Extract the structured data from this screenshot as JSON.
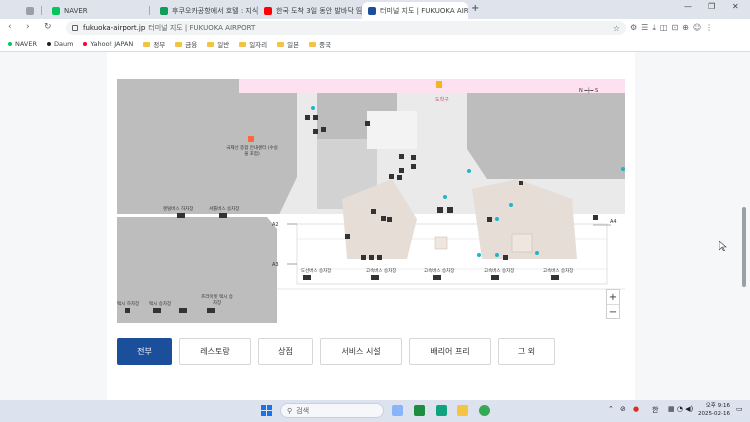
{
  "browser": {
    "tabs": [
      {
        "label": "NAVER",
        "color": "#03c75a",
        "active": false
      },
      {
        "label": "후쿠오카공항에서 호텔 : 지식",
        "color": "#0f9d58",
        "active": false
      },
      {
        "label": "한국 도착 3일 동안 발바닥 땀",
        "color": "#ff0000",
        "active": false
      },
      {
        "label": "터미널 지도 | FUKUOKA AIRP",
        "color": "#1b4f9c",
        "active": true
      }
    ],
    "new_tab": "+",
    "window_controls": {
      "minimize": "—",
      "maximize": "❐",
      "close": "✕"
    },
    "nav": {
      "back": "‹",
      "forward": "›",
      "reload": "↻"
    },
    "url_host": "fukuoka-airport.jp",
    "url_title": "터미널 지도 | FUKUOKA AIRPORT",
    "bookmarks": [
      {
        "label": "NAVER",
        "type": "dot",
        "color": "#03c75a"
      },
      {
        "label": "Daum",
        "type": "dot",
        "color": "#222222"
      },
      {
        "label": "Yahoo! JAPAN",
        "type": "dot",
        "color": "#ff0033"
      },
      {
        "label": "정부",
        "type": "folder"
      },
      {
        "label": "금융",
        "type": "folder"
      },
      {
        "label": "일반",
        "type": "folder"
      },
      {
        "label": "일자리",
        "type": "folder"
      },
      {
        "label": "일본",
        "type": "folder"
      },
      {
        "label": "중국",
        "type": "folder"
      }
    ]
  },
  "map": {
    "arrival_label": "도착구",
    "compass": "N ━┼━ S",
    "info_desk": "국제선 종합 안내센터 (수실물 포함)",
    "gates": [
      "A2",
      "A3",
      "A4"
    ],
    "bus_labels": {
      "rental_bus": "렌털버스 하차장",
      "shuttle_bus": "셔틀버스 승차장",
      "taxi_drop": "택시 하차장",
      "taxi_ride": "택시 승차장",
      "private_taxi": "프라이빗 택시 승차장",
      "domestic_bus": "도선버스 승차장",
      "express_1": "고속버스 승차장",
      "express_2": "고속버스 승차장",
      "express_3": "고속버스 승차장",
      "express_4": "고속버스 승차장"
    },
    "zoom_in": "+",
    "zoom_out": "−"
  },
  "filters": [
    {
      "label": "전부",
      "active": true
    },
    {
      "label": "레스토랑",
      "active": false
    },
    {
      "label": "상점",
      "active": false
    },
    {
      "label": "서비스 시설",
      "active": false
    },
    {
      "label": "배리어 프리",
      "active": false
    },
    {
      "label": "그 외",
      "active": false
    }
  ],
  "taskbar": {
    "search_placeholder": "검색",
    "ime": "한",
    "time": "오후 9:16",
    "date": "2025-02-16"
  }
}
